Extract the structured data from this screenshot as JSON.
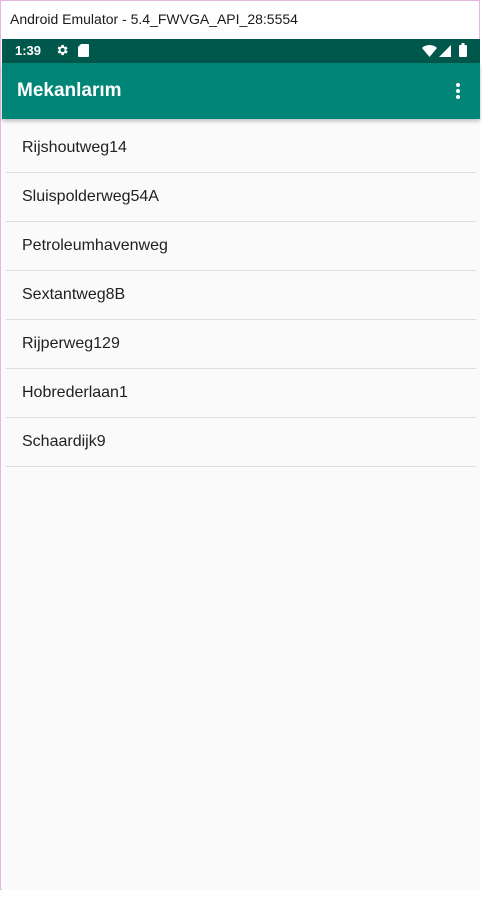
{
  "window": {
    "title": "Android Emulator - 5.4_FWVGA_API_28:5554"
  },
  "status_bar": {
    "time": "1:39",
    "icons": [
      "gear-icon",
      "sd-card-icon",
      "wifi-icon",
      "signal-icon",
      "battery-icon"
    ]
  },
  "app_bar": {
    "title": "Mekanlarım",
    "overflow_icon": "more-vert-icon"
  },
  "list": {
    "items": [
      {
        "label": "Rijshoutweg14"
      },
      {
        "label": "Sluispolderweg54A"
      },
      {
        "label": "Petroleumhavenweg"
      },
      {
        "label": "Sextantweg8B"
      },
      {
        "label": "Rijperweg129"
      },
      {
        "label": "Hobrederlaan1"
      },
      {
        "label": "Schaardijk9"
      }
    ]
  },
  "colors": {
    "status_bar": "#00574b",
    "app_bar": "#008577",
    "background": "#fafafa",
    "divider": "#dddddd",
    "text_primary": "#212121"
  }
}
